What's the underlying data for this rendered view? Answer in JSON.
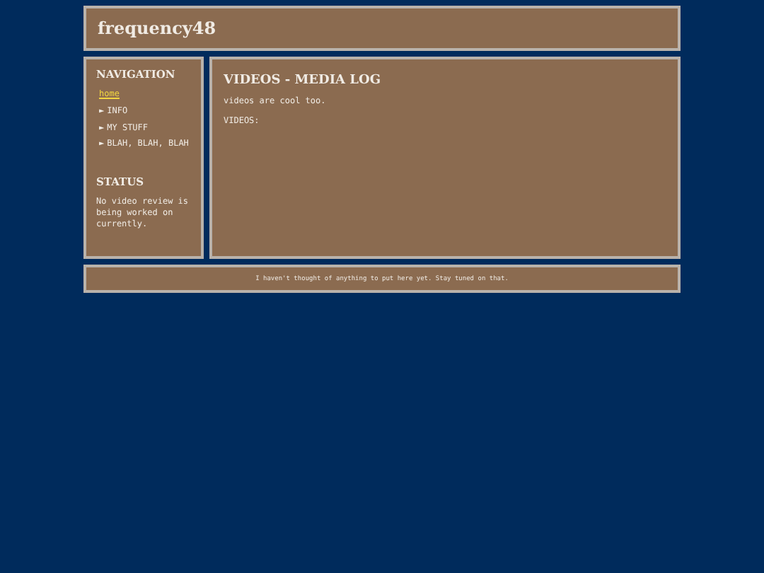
{
  "site_title": "frequency48",
  "sidebar": {
    "heading": "NAVIGATION",
    "items": [
      {
        "label": "home",
        "selected": true
      },
      {
        "label": "INFO",
        "bullet": "►",
        "selected": false
      },
      {
        "label": "MY STUFF",
        "bullet": "►",
        "selected": false
      },
      {
        "label": "BLAH, BLAH, BLAH",
        "bullet": "►",
        "selected": false
      }
    ],
    "status_heading": "STATUS",
    "status_text": "No video review is being worked on currently."
  },
  "main": {
    "heading": "VIDEOS - MEDIA LOG",
    "paragraphs": [
      "videos are cool too.",
      "VIDEOS:"
    ]
  },
  "footer": "I haven't thought of anything to put here yet. Stay tuned on that."
}
